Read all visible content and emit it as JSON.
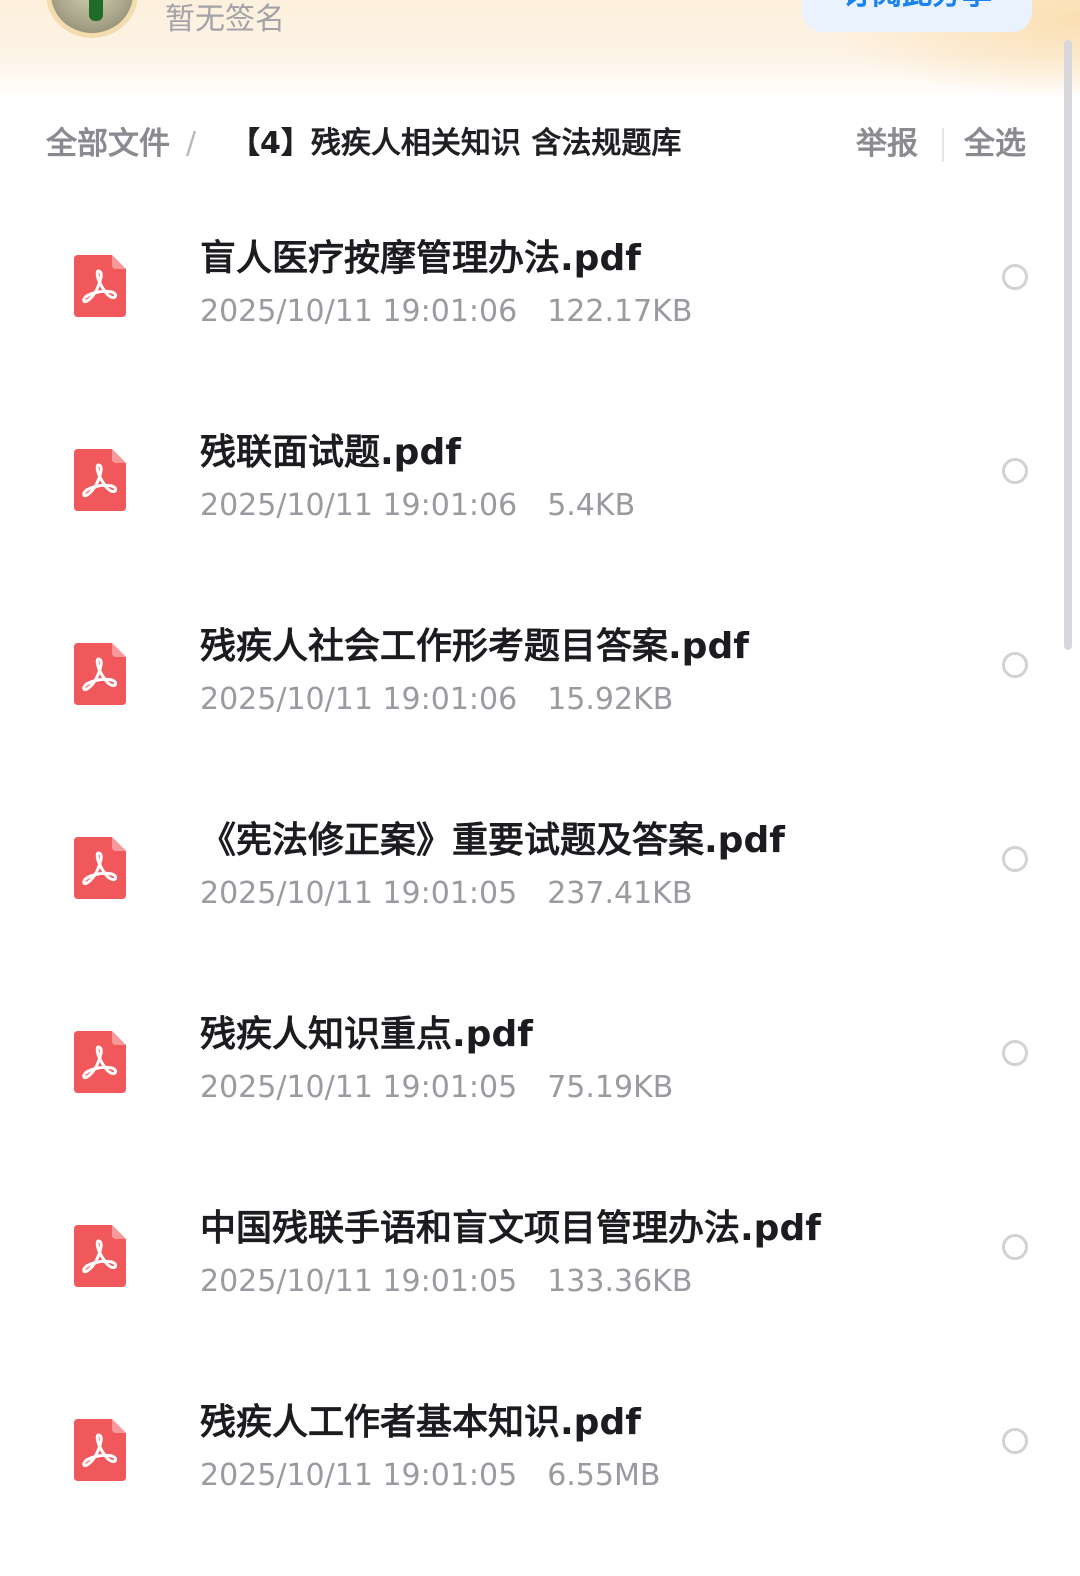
{
  "profile": {
    "signature": "暂无签名",
    "follow_button": "订阅此分享"
  },
  "breadcrumb": {
    "root": "全部文件",
    "separator": "/",
    "current": "【4】残疾人相关知识 含法规题库"
  },
  "actions": {
    "report": "举报",
    "select_all": "全选"
  },
  "files": [
    {
      "name": "盲人医疗按摩管理办法.pdf",
      "date": "2025/10/11 19:01:06",
      "size": "122.17KB",
      "icon": "pdf-icon"
    },
    {
      "name": "残联面试题.pdf",
      "date": "2025/10/11 19:01:06",
      "size": "5.4KB",
      "icon": "pdf-icon"
    },
    {
      "name": "残疾人社会工作形考题目答案.pdf",
      "date": "2025/10/11 19:01:06",
      "size": "15.92KB",
      "icon": "pdf-icon"
    },
    {
      "name": "《宪法修正案》重要试题及答案.pdf",
      "date": "2025/10/11 19:01:05",
      "size": "237.41KB",
      "icon": "pdf-icon"
    },
    {
      "name": "残疾人知识重点.pdf",
      "date": "2025/10/11 19:01:05",
      "size": "75.19KB",
      "icon": "pdf-icon"
    },
    {
      "name": "中国残联手语和盲文项目管理办法.pdf",
      "date": "2025/10/11 19:01:05",
      "size": "133.36KB",
      "icon": "pdf-icon"
    },
    {
      "name": "残疾人工作者基本知识.pdf",
      "date": "2025/10/11 19:01:05",
      "size": "6.55MB",
      "icon": "pdf-icon"
    }
  ],
  "colors": {
    "accent": "#1a82f0",
    "pdf_red": "#f0585c",
    "header_warm": "#fdf0dc"
  }
}
